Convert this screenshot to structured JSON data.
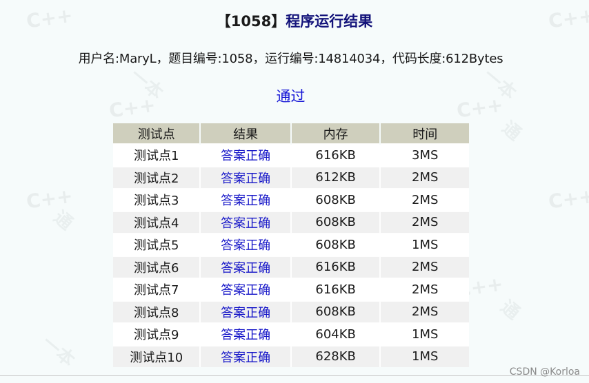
{
  "page": {
    "title_bracket_open": "【",
    "title_id": "1058",
    "title_bracket_close": "】",
    "title_text": "程序运行结果",
    "info_line": "用户名:MaryL，题目编号:1058，运行编号:14814034，代码长度:612Bytes",
    "status": "通过",
    "credit": "CSDN @Korloa"
  },
  "watermark": {
    "text_cpp": "C++",
    "text_cn_1": "一本",
    "text_cn_2": "通"
  },
  "table": {
    "headers": [
      "测试点",
      "结果",
      "内存",
      "时间"
    ],
    "rows": [
      {
        "case": "测试点1",
        "result": "答案正确",
        "memory": "616KB",
        "time": "3MS"
      },
      {
        "case": "测试点2",
        "result": "答案正确",
        "memory": "612KB",
        "time": "2MS"
      },
      {
        "case": "测试点3",
        "result": "答案正确",
        "memory": "608KB",
        "time": "2MS"
      },
      {
        "case": "测试点4",
        "result": "答案正确",
        "memory": "608KB",
        "time": "2MS"
      },
      {
        "case": "测试点5",
        "result": "答案正确",
        "memory": "608KB",
        "time": "1MS"
      },
      {
        "case": "测试点6",
        "result": "答案正确",
        "memory": "616KB",
        "time": "2MS"
      },
      {
        "case": "测试点7",
        "result": "答案正确",
        "memory": "616KB",
        "time": "2MS"
      },
      {
        "case": "测试点8",
        "result": "答案正确",
        "memory": "608KB",
        "time": "2MS"
      },
      {
        "case": "测试点9",
        "result": "答案正确",
        "memory": "604KB",
        "time": "1MS"
      },
      {
        "case": "测试点10",
        "result": "答案正确",
        "memory": "628KB",
        "time": "1MS"
      }
    ]
  },
  "colors": {
    "background": "#f6fbfb",
    "title": "#13137a",
    "status": "#1515d6",
    "result_text": "#1515c8",
    "header_bg": "#cfcfbd",
    "row_even_bg": "#f0f0f0"
  }
}
